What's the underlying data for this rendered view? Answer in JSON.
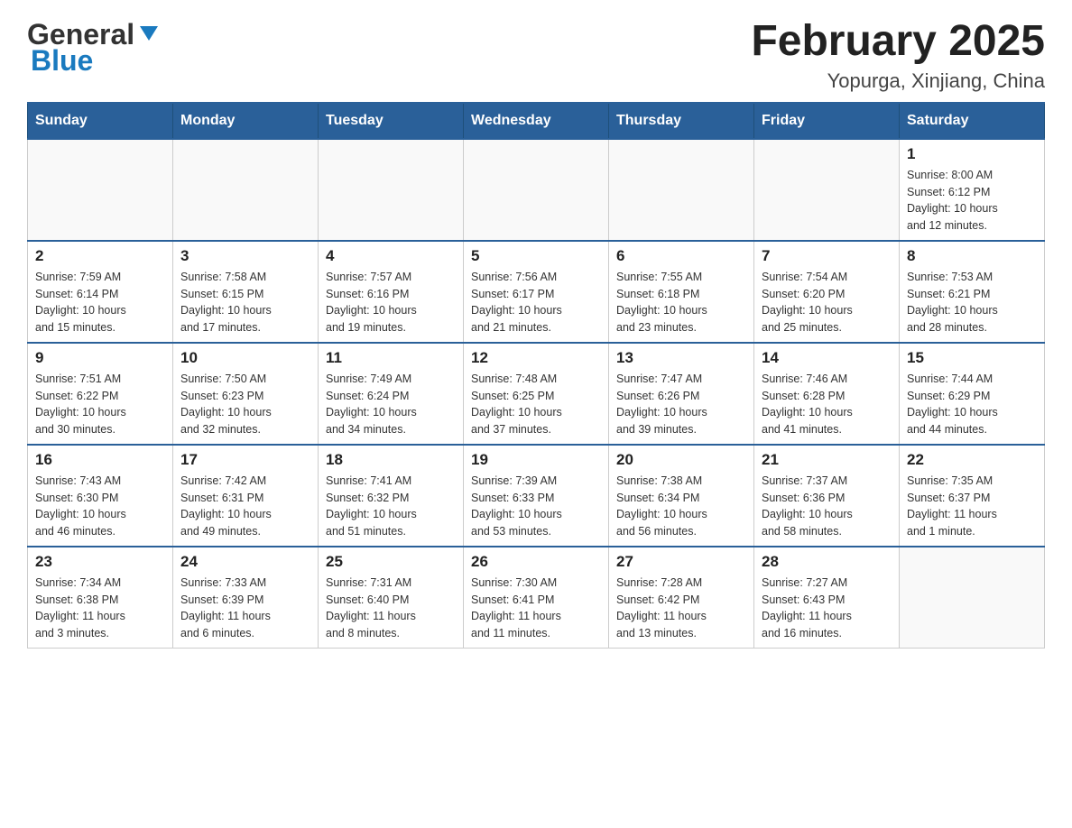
{
  "header": {
    "logo_general": "General",
    "logo_blue": "Blue",
    "title": "February 2025",
    "subtitle": "Yopurga, Xinjiang, China"
  },
  "weekdays": [
    "Sunday",
    "Monday",
    "Tuesday",
    "Wednesday",
    "Thursday",
    "Friday",
    "Saturday"
  ],
  "weeks": [
    [
      {
        "day": "",
        "info": ""
      },
      {
        "day": "",
        "info": ""
      },
      {
        "day": "",
        "info": ""
      },
      {
        "day": "",
        "info": ""
      },
      {
        "day": "",
        "info": ""
      },
      {
        "day": "",
        "info": ""
      },
      {
        "day": "1",
        "info": "Sunrise: 8:00 AM\nSunset: 6:12 PM\nDaylight: 10 hours\nand 12 minutes."
      }
    ],
    [
      {
        "day": "2",
        "info": "Sunrise: 7:59 AM\nSunset: 6:14 PM\nDaylight: 10 hours\nand 15 minutes."
      },
      {
        "day": "3",
        "info": "Sunrise: 7:58 AM\nSunset: 6:15 PM\nDaylight: 10 hours\nand 17 minutes."
      },
      {
        "day": "4",
        "info": "Sunrise: 7:57 AM\nSunset: 6:16 PM\nDaylight: 10 hours\nand 19 minutes."
      },
      {
        "day": "5",
        "info": "Sunrise: 7:56 AM\nSunset: 6:17 PM\nDaylight: 10 hours\nand 21 minutes."
      },
      {
        "day": "6",
        "info": "Sunrise: 7:55 AM\nSunset: 6:18 PM\nDaylight: 10 hours\nand 23 minutes."
      },
      {
        "day": "7",
        "info": "Sunrise: 7:54 AM\nSunset: 6:20 PM\nDaylight: 10 hours\nand 25 minutes."
      },
      {
        "day": "8",
        "info": "Sunrise: 7:53 AM\nSunset: 6:21 PM\nDaylight: 10 hours\nand 28 minutes."
      }
    ],
    [
      {
        "day": "9",
        "info": "Sunrise: 7:51 AM\nSunset: 6:22 PM\nDaylight: 10 hours\nand 30 minutes."
      },
      {
        "day": "10",
        "info": "Sunrise: 7:50 AM\nSunset: 6:23 PM\nDaylight: 10 hours\nand 32 minutes."
      },
      {
        "day": "11",
        "info": "Sunrise: 7:49 AM\nSunset: 6:24 PM\nDaylight: 10 hours\nand 34 minutes."
      },
      {
        "day": "12",
        "info": "Sunrise: 7:48 AM\nSunset: 6:25 PM\nDaylight: 10 hours\nand 37 minutes."
      },
      {
        "day": "13",
        "info": "Sunrise: 7:47 AM\nSunset: 6:26 PM\nDaylight: 10 hours\nand 39 minutes."
      },
      {
        "day": "14",
        "info": "Sunrise: 7:46 AM\nSunset: 6:28 PM\nDaylight: 10 hours\nand 41 minutes."
      },
      {
        "day": "15",
        "info": "Sunrise: 7:44 AM\nSunset: 6:29 PM\nDaylight: 10 hours\nand 44 minutes."
      }
    ],
    [
      {
        "day": "16",
        "info": "Sunrise: 7:43 AM\nSunset: 6:30 PM\nDaylight: 10 hours\nand 46 minutes."
      },
      {
        "day": "17",
        "info": "Sunrise: 7:42 AM\nSunset: 6:31 PM\nDaylight: 10 hours\nand 49 minutes."
      },
      {
        "day": "18",
        "info": "Sunrise: 7:41 AM\nSunset: 6:32 PM\nDaylight: 10 hours\nand 51 minutes."
      },
      {
        "day": "19",
        "info": "Sunrise: 7:39 AM\nSunset: 6:33 PM\nDaylight: 10 hours\nand 53 minutes."
      },
      {
        "day": "20",
        "info": "Sunrise: 7:38 AM\nSunset: 6:34 PM\nDaylight: 10 hours\nand 56 minutes."
      },
      {
        "day": "21",
        "info": "Sunrise: 7:37 AM\nSunset: 6:36 PM\nDaylight: 10 hours\nand 58 minutes."
      },
      {
        "day": "22",
        "info": "Sunrise: 7:35 AM\nSunset: 6:37 PM\nDaylight: 11 hours\nand 1 minute."
      }
    ],
    [
      {
        "day": "23",
        "info": "Sunrise: 7:34 AM\nSunset: 6:38 PM\nDaylight: 11 hours\nand 3 minutes."
      },
      {
        "day": "24",
        "info": "Sunrise: 7:33 AM\nSunset: 6:39 PM\nDaylight: 11 hours\nand 6 minutes."
      },
      {
        "day": "25",
        "info": "Sunrise: 7:31 AM\nSunset: 6:40 PM\nDaylight: 11 hours\nand 8 minutes."
      },
      {
        "day": "26",
        "info": "Sunrise: 7:30 AM\nSunset: 6:41 PM\nDaylight: 11 hours\nand 11 minutes."
      },
      {
        "day": "27",
        "info": "Sunrise: 7:28 AM\nSunset: 6:42 PM\nDaylight: 11 hours\nand 13 minutes."
      },
      {
        "day": "28",
        "info": "Sunrise: 7:27 AM\nSunset: 6:43 PM\nDaylight: 11 hours\nand 16 minutes."
      },
      {
        "day": "",
        "info": ""
      }
    ]
  ]
}
